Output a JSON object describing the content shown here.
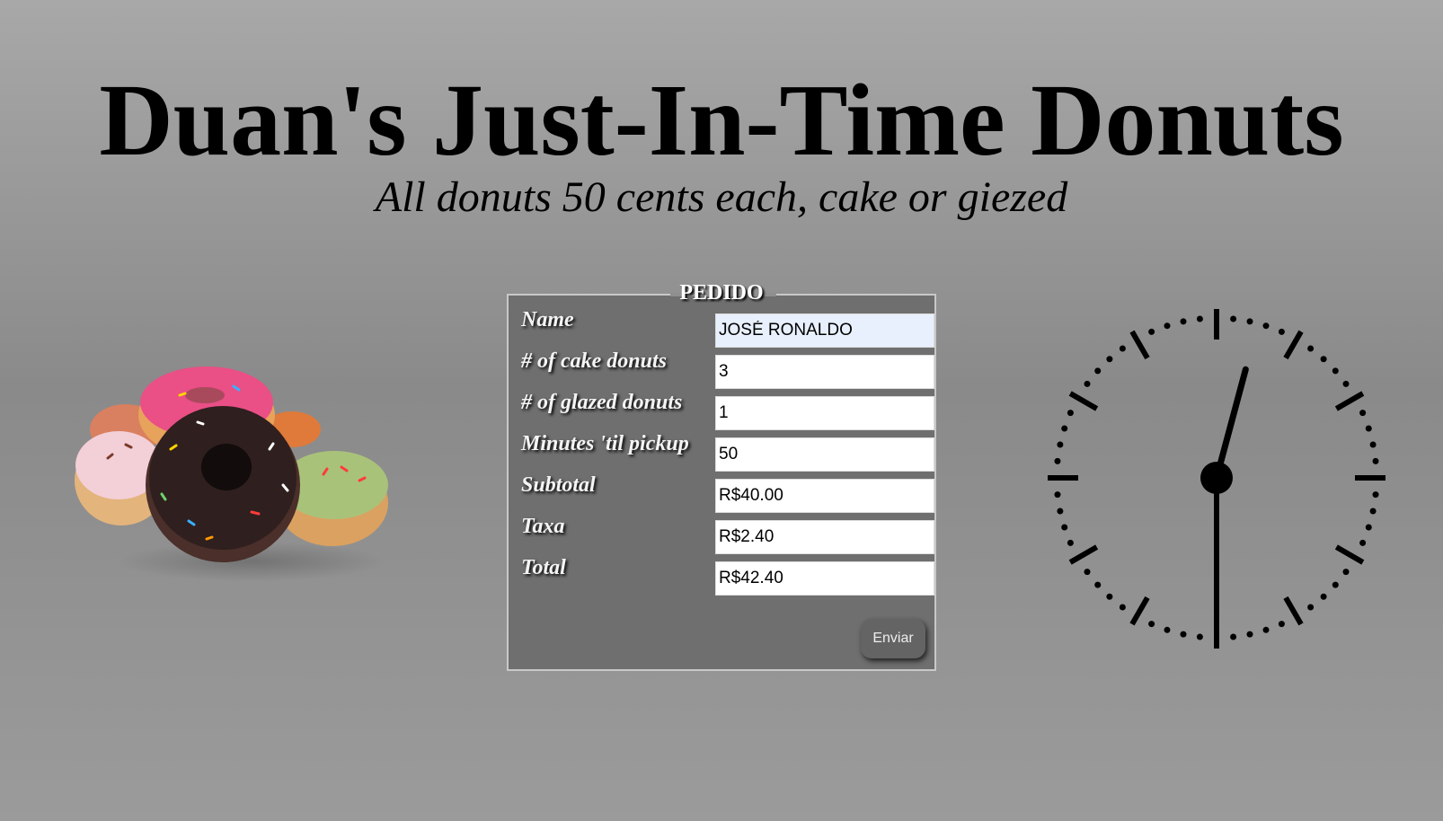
{
  "header": {
    "title": "Duan's Just-In-Time Donuts",
    "subtitle": "All donuts 50 cents each, cake or giezed"
  },
  "order_form": {
    "legend": "PEDIDO",
    "fields": [
      {
        "label": "Name",
        "value": "JOSÉ RONALDO",
        "autofilled": true
      },
      {
        "label": "# of cake donuts",
        "value": "3"
      },
      {
        "label": "# of glazed donuts",
        "value": "1"
      },
      {
        "label": "Minutes 'til pickup",
        "value": "50"
      },
      {
        "label": "Subtotal",
        "value": "R$40.00"
      },
      {
        "label": "Taxa",
        "value": "R$2.40"
      },
      {
        "label": "Total",
        "value": "R$42.40"
      }
    ],
    "submit_label": "Enviar"
  },
  "clock": {
    "hours": 12,
    "minutes": 30,
    "style": "analog, black tick marks"
  },
  "images": {
    "donuts": "stack of frosted donuts with sprinkles"
  },
  "colors": {
    "background_top": "#a8a8a8",
    "background_mid": "#8a8a8a",
    "form_panel": "#6f6f6f",
    "input_autofill": "#e8f0fe"
  }
}
